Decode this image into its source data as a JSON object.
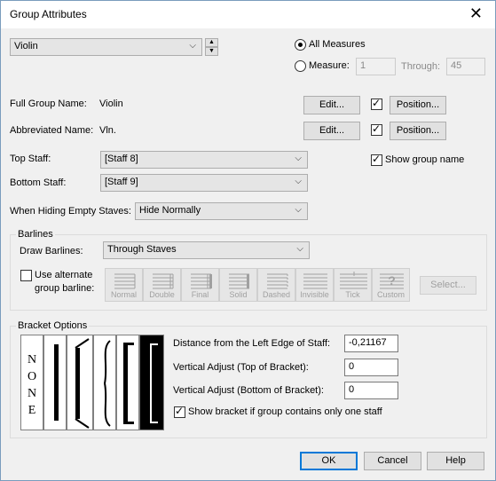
{
  "window": {
    "title": "Group Attributes",
    "close_glyph": "✕"
  },
  "group_select": {
    "value": "Violin"
  },
  "measures": {
    "all_label": "All Measures",
    "measure_label": "Measure:",
    "measure_value": "1",
    "through_label": "Through:",
    "through_value": "45",
    "all_selected": true
  },
  "names": {
    "full_label": "Full Group Name:",
    "full_value": "Violin",
    "abbr_label": "Abbreviated Name:",
    "abbr_value": "Vln.",
    "edit_label": "Edit...",
    "position_label": "Position..."
  },
  "staves": {
    "top_label": "Top Staff:",
    "top_value": "[Staff 8]",
    "bottom_label": "Bottom Staff:",
    "bottom_value": "[Staff 9]",
    "show_group_name_label": "Show group name"
  },
  "hiding": {
    "label": "When Hiding Empty Staves:",
    "value": "Hide Normally"
  },
  "barlines": {
    "group_title": "Barlines",
    "draw_label": "Draw Barlines:",
    "draw_value": "Through Staves",
    "alt_label_1": "Use alternate",
    "alt_label_2": "group barline:",
    "types": [
      "Normal",
      "Double",
      "Final",
      "Solid",
      "Dashed",
      "Invisible",
      "Tick",
      "Custom"
    ],
    "select_label": "Select..."
  },
  "bracket": {
    "group_title": "Bracket Options",
    "none_letters": [
      "N",
      "O",
      "N",
      "E"
    ],
    "distance_label": "Distance from the Left Edge of Staff:",
    "distance_value": "-0,21167",
    "vtop_label": "Vertical Adjust (Top of Bracket):",
    "vtop_value": "0",
    "vbottom_label": "Vertical Adjust (Bottom of Bracket):",
    "vbottom_value": "0",
    "show_one_label": "Show bracket if group contains only one staff"
  },
  "footer": {
    "ok_label": "OK",
    "cancel_label": "Cancel",
    "help_label": "Help"
  },
  "colors": {
    "accent": "#0078d7",
    "window_bg": "#f0f0f0"
  }
}
